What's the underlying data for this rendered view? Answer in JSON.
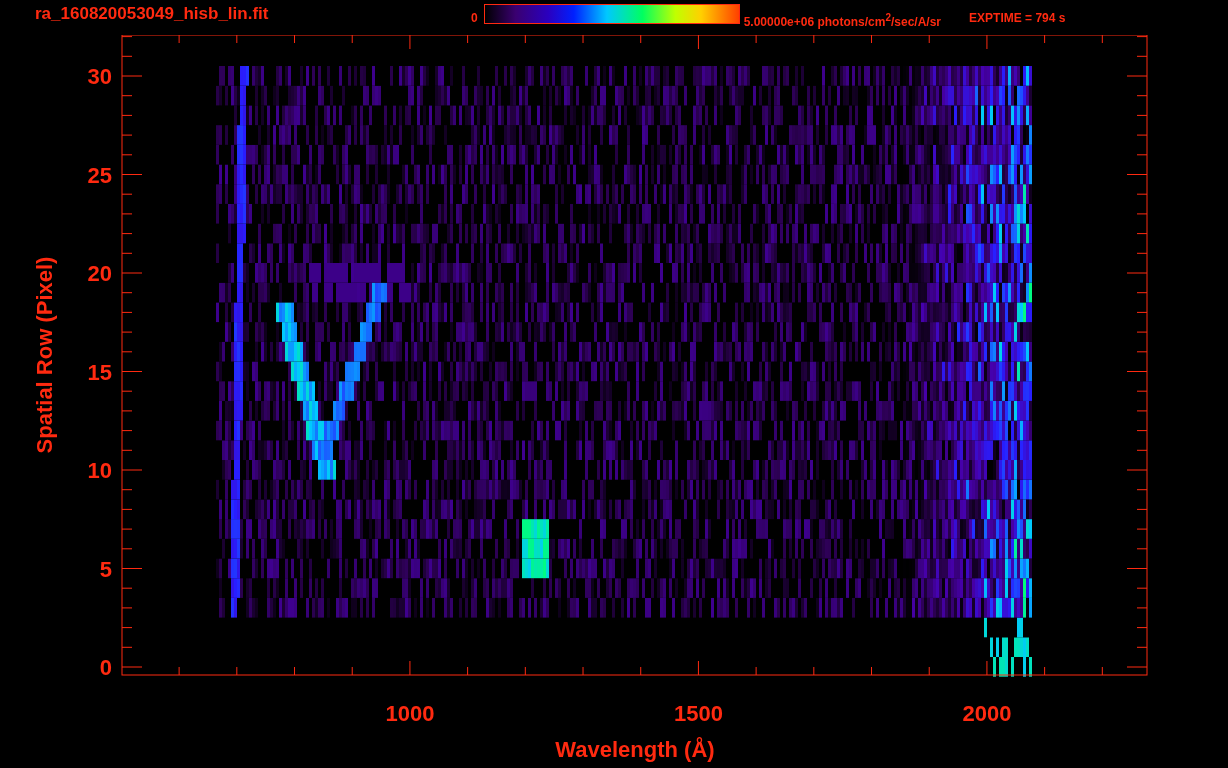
{
  "header": {
    "filename": "ra_160820053049_hisb_lin.fit",
    "colorbar": {
      "min_label": "0",
      "max_label": "5.00000e+06 photons/cm$^{2}$/sec/A/sr"
    },
    "exposure": "EXPTIME = 794 s"
  },
  "plot": {
    "xlabel": "Wavelength (Å)",
    "ylabel": "Spatial Row (Pixel)",
    "xticks": [
      "1000",
      "1500",
      "2000"
    ],
    "yticks": [
      "30",
      "25",
      "20",
      "15",
      "10",
      "5",
      "0"
    ]
  }
}
